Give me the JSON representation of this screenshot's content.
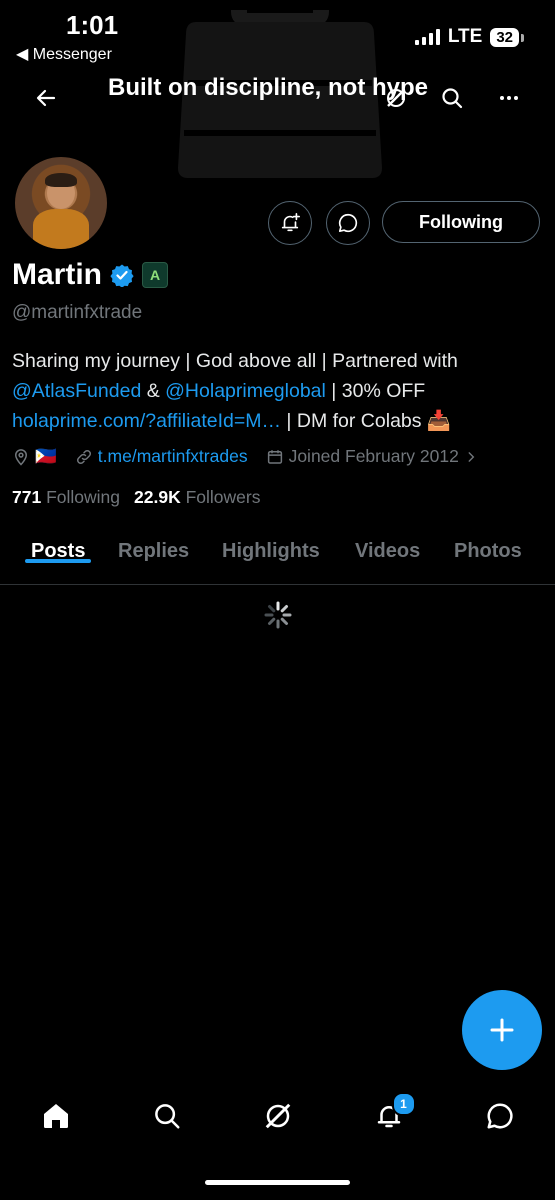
{
  "status_bar": {
    "time": "1:01",
    "back_app": "◀ Messenger",
    "network": "LTE",
    "battery": "32"
  },
  "header": {
    "banner_title": "Built on discipline, not hype"
  },
  "profile": {
    "follow_button": "Following",
    "name": "Martin",
    "affiliate_badge": "A",
    "handle": "@martinfxtrade",
    "bio": {
      "line1": "Sharing my journey | God above all | Partnered with",
      "mention1": "@AtlasFunded",
      "amp": " & ",
      "mention2": "@Holaprimeglobal",
      "after_mention2": " | 30% OFF",
      "link": "holaprime.com/?affiliateId=M…",
      "after_link": " | DM for Colabs ",
      "emoji": "📥"
    },
    "location_flag": "🇵🇭",
    "website": "t.me/martinfxtrades",
    "joined": "Joined February 2012",
    "following_count": "771",
    "following_label": "Following",
    "followers_count": "22.9K",
    "followers_label": "Followers"
  },
  "tabs": [
    "Posts",
    "Replies",
    "Highlights",
    "Videos",
    "Photos"
  ],
  "nav": {
    "notification_badge": "1"
  },
  "colors": {
    "accent": "#1d9bf0",
    "background": "#000000",
    "muted": "#71767b"
  }
}
